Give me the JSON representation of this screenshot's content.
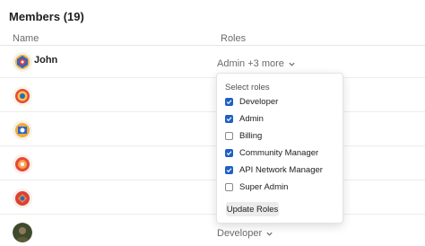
{
  "page": {
    "title": "Members (19)"
  },
  "table": {
    "columns": {
      "name": "Name",
      "roles": "Roles"
    },
    "members": [
      {
        "name": "John",
        "roles_summary": "Admin +3 more",
        "avatar": "badge-blue-red-icon"
      },
      {
        "name": "",
        "roles_summary": "",
        "avatar": "badge-red-yellow-icon"
      },
      {
        "name": "",
        "roles_summary": "",
        "avatar": "badge-blue-yellow-icon"
      },
      {
        "name": "",
        "roles_summary": "",
        "avatar": "badge-red-orange-icon"
      },
      {
        "name": "",
        "roles_summary": "",
        "avatar": "badge-red-blue-icon"
      },
      {
        "name": "",
        "roles_summary": "Developer",
        "avatar": "photo-avatar"
      }
    ]
  },
  "role_menu": {
    "title": "Select roles",
    "options": [
      {
        "label": "Developer",
        "checked": true
      },
      {
        "label": "Admin",
        "checked": true
      },
      {
        "label": "Billing",
        "checked": false
      },
      {
        "label": "Community Manager",
        "checked": true
      },
      {
        "label": "API Network Manager",
        "checked": true
      },
      {
        "label": "Super Admin",
        "checked": false
      }
    ],
    "submit_label": "Update Roles"
  },
  "colors": {
    "accent": "#1f5fc6",
    "muted": "#6b6b6b"
  }
}
